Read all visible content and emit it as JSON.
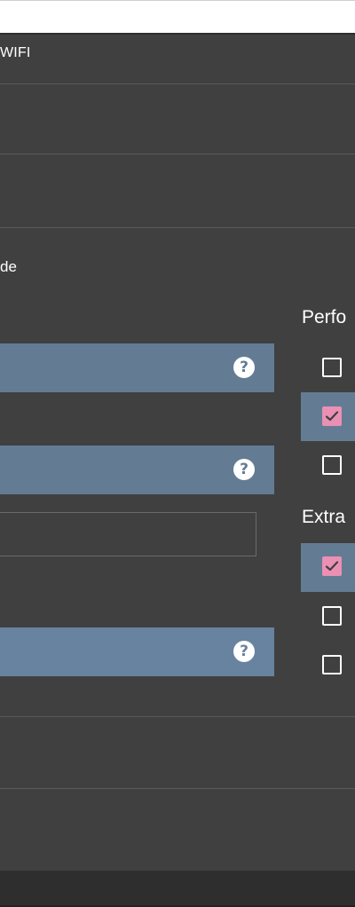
{
  "header": {
    "title": "WIFI"
  },
  "settings": {
    "mode_text": "de",
    "help_glyph": "?",
    "text_input_value": ""
  },
  "right_panel": {
    "performance_title": "Perfo",
    "extra_title": "Extra",
    "performance_options": [
      {
        "checked": false
      },
      {
        "checked": true
      },
      {
        "checked": false
      }
    ],
    "extra_options": [
      {
        "checked": true
      },
      {
        "checked": false
      },
      {
        "checked": false
      }
    ]
  },
  "colors": {
    "background": "#404040",
    "accent_bar": "#637c94",
    "check_fill": "#ea90b4"
  }
}
